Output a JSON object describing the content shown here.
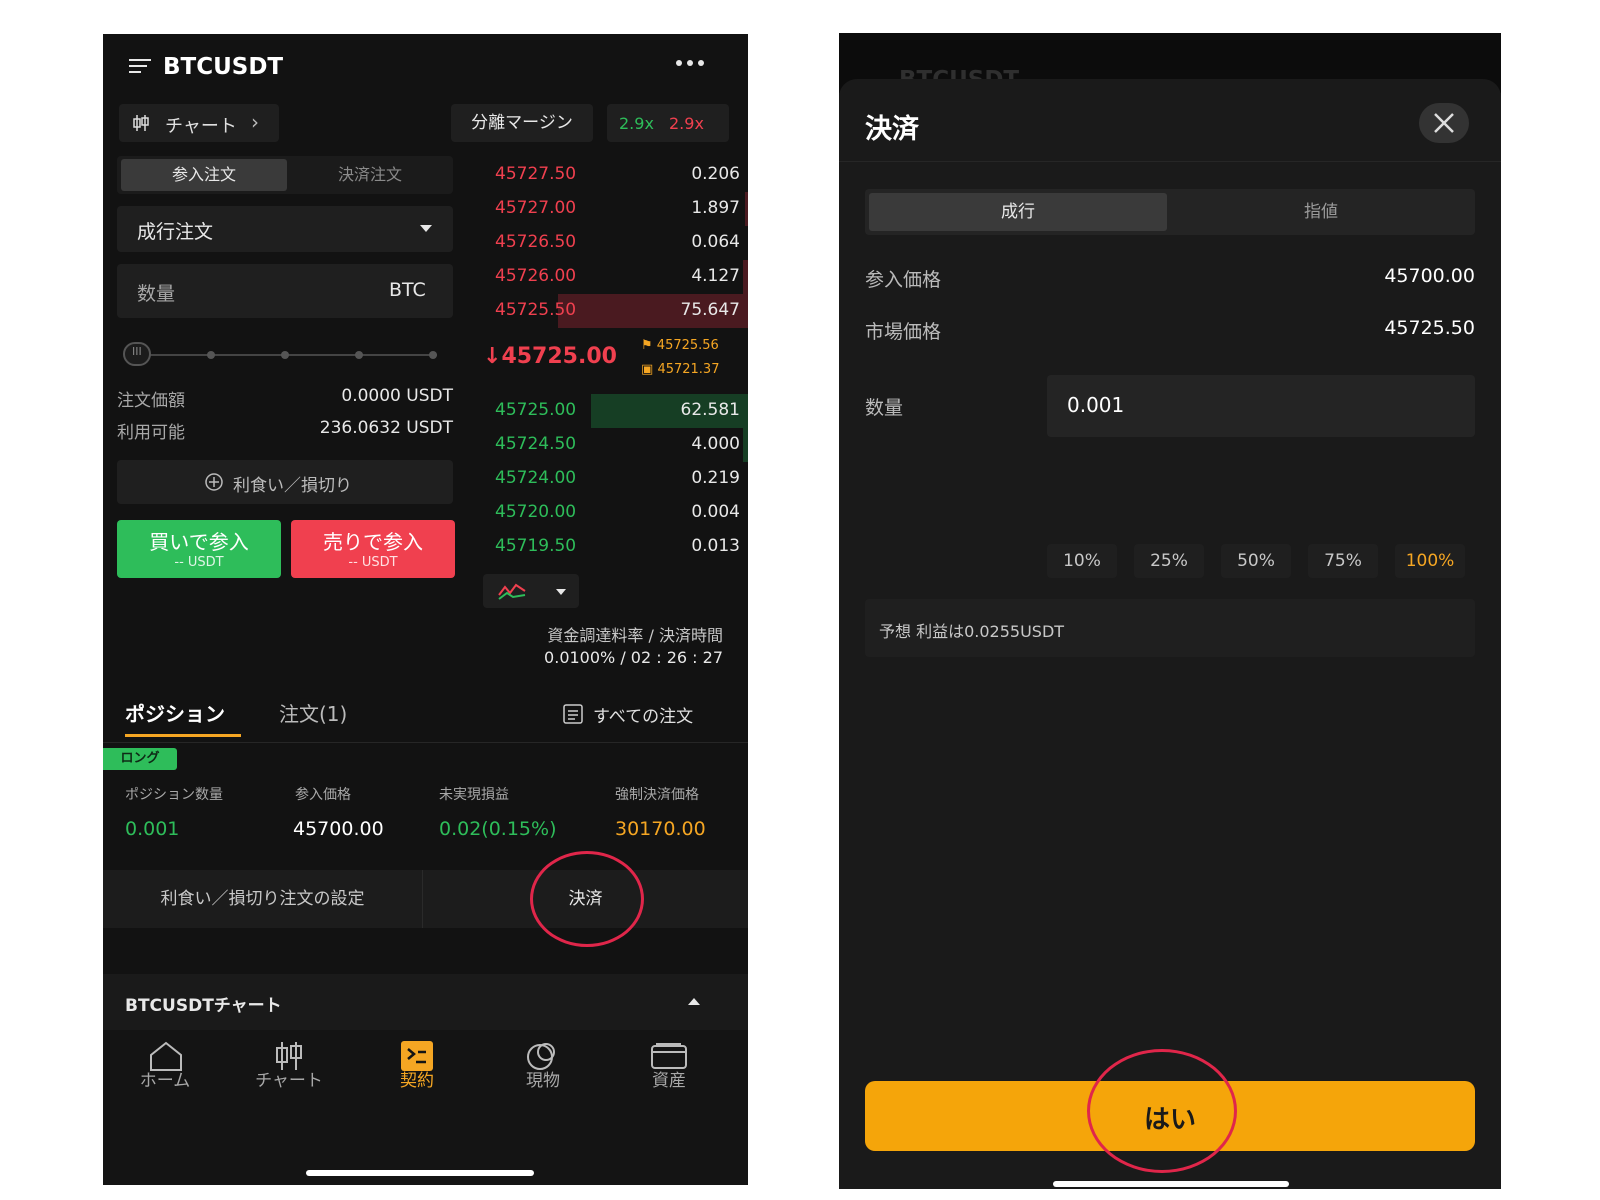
{
  "left": {
    "header": {
      "title": "BTCUSDT"
    },
    "chart_button": "チャート",
    "margin_mode": "分離マージン",
    "leverage_long": "2.9x",
    "leverage_short": "2.9x",
    "order_tabs": [
      "参入注文",
      "決済注文"
    ],
    "order_type": "成行注文",
    "quantity_label": "数量",
    "quantity_unit": "BTC",
    "order_value_label": "注文価額",
    "order_value": "0.0000 USDT",
    "available_label": "利用可能",
    "available": "236.0632 USDT",
    "tpsl_button": "利食い／損切り",
    "buy_button": {
      "label": "買いで参入",
      "sub": "-- USDT"
    },
    "sell_button": {
      "label": "売りで参入",
      "sub": "-- USDT"
    },
    "orderbook": {
      "asks": [
        {
          "price": "45727.50",
          "qty": "0.206",
          "depth": 0.0
        },
        {
          "price": "45727.00",
          "qty": "1.897",
          "depth": 0.01
        },
        {
          "price": "45726.50",
          "qty": "0.064",
          "depth": 0.0
        },
        {
          "price": "45726.00",
          "qty": "4.127",
          "depth": 0.02
        },
        {
          "price": "45725.50",
          "qty": "75.647",
          "depth": 0.74
        }
      ],
      "last_price": "45725.00",
      "mark_price": "45725.56",
      "index_price": "45721.37",
      "bids": [
        {
          "price": "45725.00",
          "qty": "62.581",
          "depth": 0.61
        },
        {
          "price": "45724.50",
          "qty": "4.000",
          "depth": 0.02
        },
        {
          "price": "45724.00",
          "qty": "0.219",
          "depth": 0.0
        },
        {
          "price": "45720.00",
          "qty": "0.004",
          "depth": 0.0
        },
        {
          "price": "45719.50",
          "qty": "0.013",
          "depth": 0.0
        }
      ]
    },
    "funding_label": "資金調達料率 / 決済時間",
    "funding_value": "0.0100% / 02 : 26 : 27",
    "position_tabs": [
      "ポジション",
      "注文(1)"
    ],
    "all_orders": "すべての注文",
    "position": {
      "side_badge": "ロング",
      "headers": [
        "ポジション数量",
        "参入価格",
        "未実現損益",
        "強制決済価格"
      ],
      "quantity": "0.001",
      "entry_price": "45700.00",
      "pnl": "0.02(0.15%)",
      "liq_price": "30170.00"
    },
    "tpsl_setting": "利食い／損切り注文の設定",
    "close_button": "決済",
    "chart_section": "BTCUSDTチャート",
    "tabbar": [
      "ホーム",
      "チャート",
      "契約",
      "現物",
      "資産"
    ],
    "colors": {
      "buy": "#2ebd5a",
      "sell": "#f0404f",
      "accent": "#f5a623"
    }
  },
  "right": {
    "behind_title": "BTCUSDT",
    "title": "決済",
    "tabs": [
      "成行",
      "指値"
    ],
    "entry_price_label": "参入価格",
    "entry_price": "45700.00",
    "market_price_label": "市場価格",
    "market_price": "45725.50",
    "quantity_label": "数量",
    "quantity_value": "0.001",
    "percents": [
      "10%",
      "25%",
      "50%",
      "75%",
      "100%"
    ],
    "expected_profit": "予想 利益は0.0255USDT",
    "confirm_button": "はい",
    "colors": {
      "confirm": "#f5a50a",
      "highlight_circle": "#e0264a"
    }
  }
}
